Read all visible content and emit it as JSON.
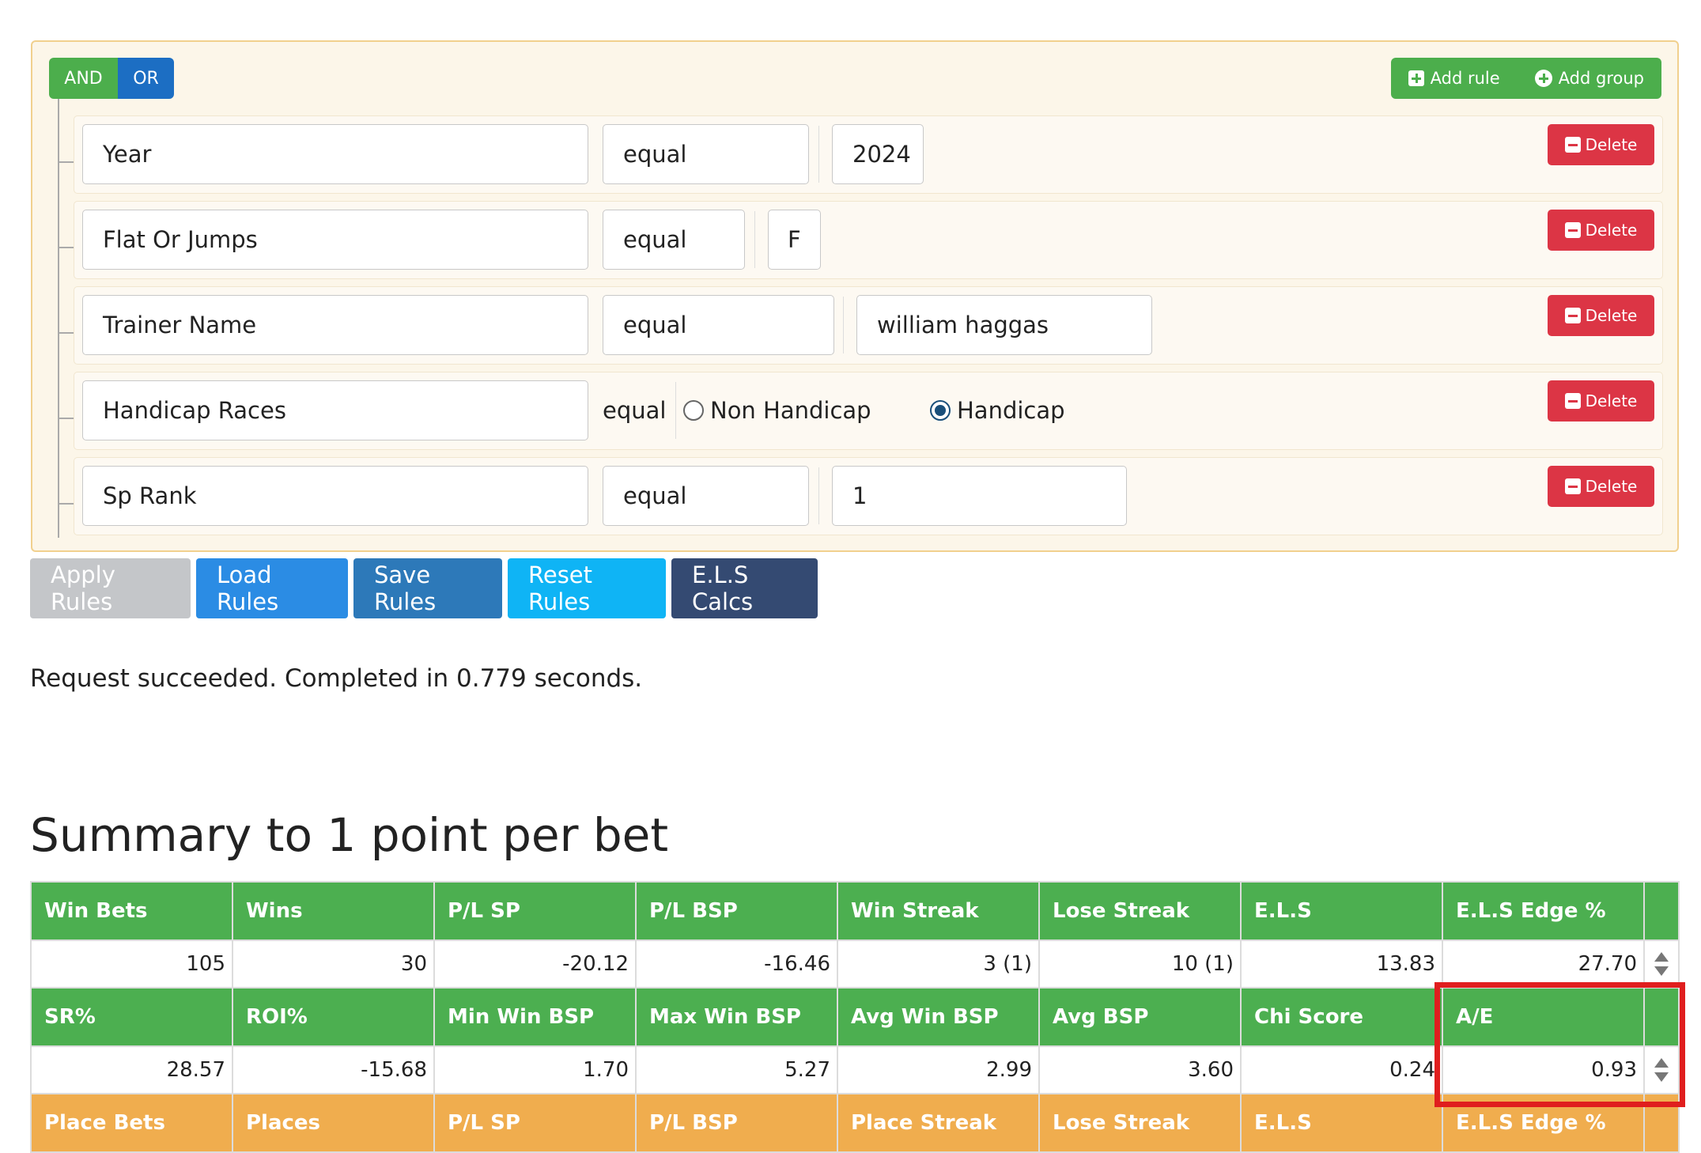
{
  "builder": {
    "and_label": "AND",
    "or_label": "OR",
    "add_rule_label": "Add rule",
    "add_group_label": "Add group",
    "delete_label": "Delete",
    "rules": [
      {
        "field": "Year",
        "operator": "equal",
        "value": "2024"
      },
      {
        "field": "Flat Or Jumps",
        "operator": "equal",
        "value": "F"
      },
      {
        "field": "Trainer Name",
        "operator": "equal",
        "value": "william haggas"
      },
      {
        "field": "Handicap Races",
        "operator": "equal",
        "options": [
          "Non Handicap",
          "Handicap"
        ],
        "selected": "Handicap"
      },
      {
        "field": "Sp Rank",
        "operator": "equal",
        "value": "1"
      }
    ]
  },
  "actions": {
    "apply": "Apply Rules",
    "load": "Load Rules",
    "save": "Save Rules",
    "reset": "Reset Rules",
    "els": "E.L.S Calcs"
  },
  "status": "Request succeeded. Completed in 0.779 seconds.",
  "summary": {
    "title": "Summary to 1 point per bet",
    "row1_headers": [
      "Win Bets",
      "Wins",
      "P/L SP",
      "P/L BSP",
      "Win Streak",
      "Lose Streak",
      "E.L.S",
      "E.L.S Edge %"
    ],
    "row1_values": [
      "105",
      "30",
      "-20.12",
      "-16.46",
      "3 (1)",
      "10 (1)",
      "13.83",
      "27.70"
    ],
    "row2_headers": [
      "SR%",
      "ROI%",
      "Min Win BSP",
      "Max Win BSP",
      "Avg Win BSP",
      "Avg BSP",
      "Chi Score",
      "A/E"
    ],
    "row2_values": [
      "28.57",
      "-15.68",
      "1.70",
      "5.27",
      "2.99",
      "3.60",
      "0.24",
      "0.93"
    ],
    "row3_headers": [
      "Place Bets",
      "Places",
      "P/L SP",
      "P/L BSP",
      "Place Streak",
      "Lose Streak",
      "E.L.S",
      "E.L.S Edge %"
    ]
  },
  "colors": {
    "green": "#4caf50",
    "orange": "#f0ad4e",
    "delete_red": "#dc3545",
    "highlight_red": "#e01e1e"
  }
}
